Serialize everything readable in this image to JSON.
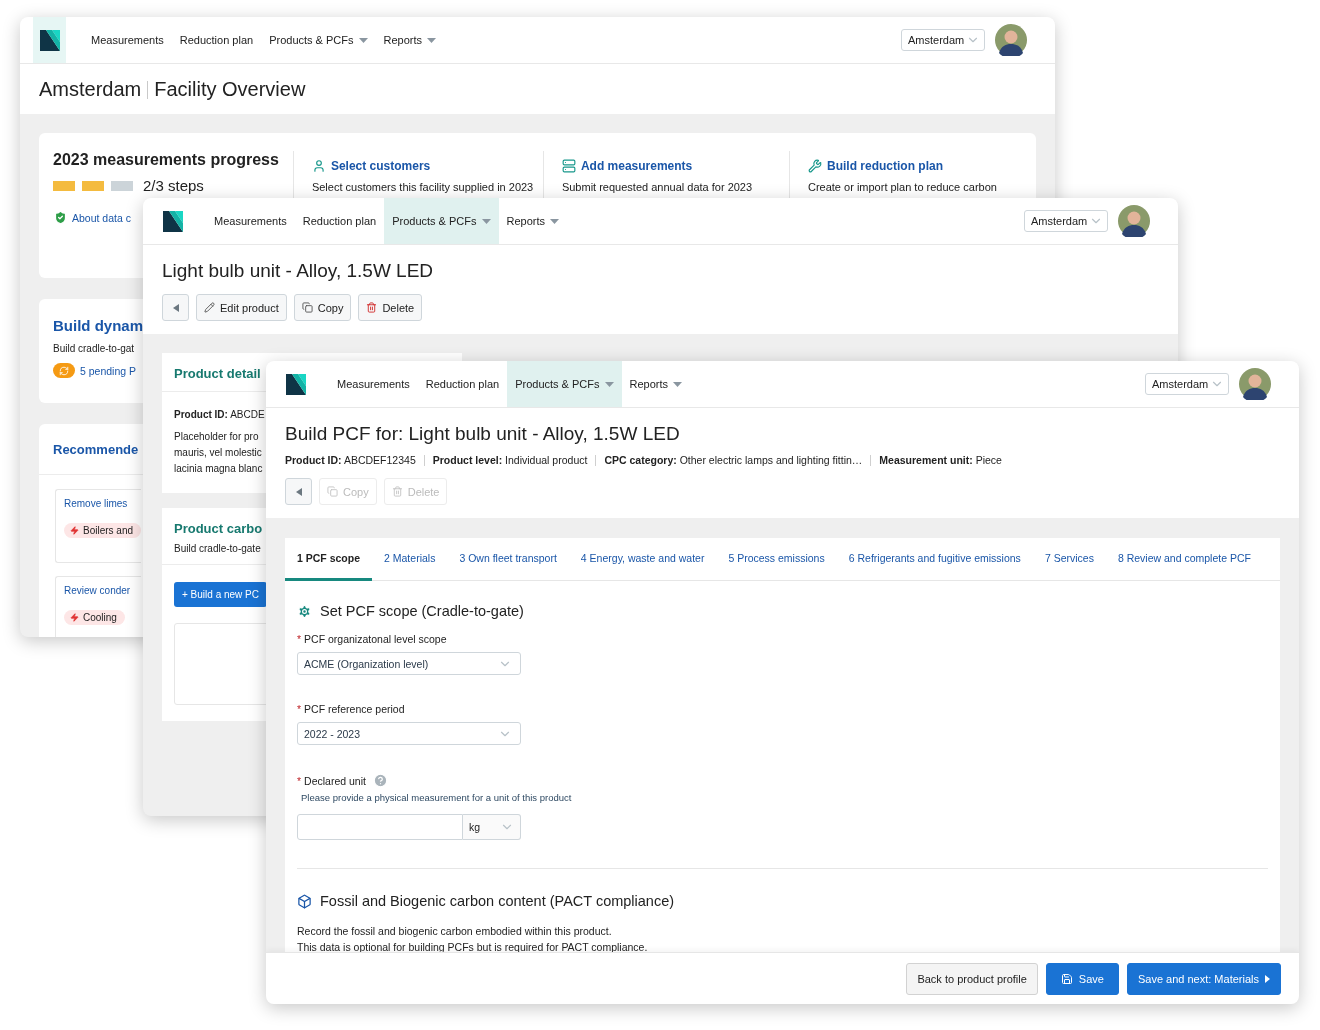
{
  "facility_window": {
    "nav": {
      "home_selected": true,
      "items": [
        {
          "label": "Measurements",
          "has_menu": false,
          "selected": false
        },
        {
          "label": "Reduction plan",
          "has_menu": false,
          "selected": false
        },
        {
          "label": "Products & PCFs",
          "has_menu": true,
          "selected": false
        },
        {
          "label": "Reports",
          "has_menu": true,
          "selected": false
        }
      ],
      "location": "Amsterdam"
    },
    "title": {
      "location": "Amsterdam",
      "page": "Facility Overview"
    },
    "progress": {
      "title": "2023 measurements progress",
      "steps": [
        {
          "done": true
        },
        {
          "done": true
        },
        {
          "done": false
        }
      ],
      "steps_text": "2/3 steps",
      "about_link": "About data c",
      "tasks": [
        {
          "kind": "customers",
          "title": "Select customers",
          "text": "Select customers this facility supplied in 2023"
        },
        {
          "kind": "measurements",
          "title": "Add measurements",
          "text": "Submit requested annual data for 2023"
        },
        {
          "kind": "plan",
          "title": "Build reduction plan",
          "text": "Create or import plan to reduce carbon"
        }
      ]
    },
    "build_card": {
      "title": "Build dynam",
      "text": "Build cradle-to-gat",
      "badge": "5 pending P"
    },
    "recommendations": {
      "title": "Recommende",
      "items": [
        {
          "title": "Remove limes",
          "tag": "Boilers and"
        },
        {
          "title": "Review conder",
          "tag": "Cooling"
        }
      ]
    }
  },
  "product_window": {
    "nav": {
      "home_selected": false,
      "items": [
        {
          "label": "Measurements",
          "has_menu": false,
          "selected": false
        },
        {
          "label": "Reduction plan",
          "has_menu": false,
          "selected": false
        },
        {
          "label": "Products & PCFs",
          "has_menu": true,
          "selected": true
        },
        {
          "label": "Reports",
          "has_menu": true,
          "selected": false
        }
      ],
      "location": "Amsterdam"
    },
    "title": "Light bulb unit - Alloy, 1.5W LED",
    "actions": [
      {
        "kind": "back",
        "disabled": false
      },
      {
        "kind": "edit",
        "label": "Edit product",
        "disabled": false
      },
      {
        "kind": "copy",
        "label": "Copy",
        "disabled": false
      },
      {
        "kind": "delete",
        "label": "Delete",
        "disabled": false
      }
    ],
    "details": {
      "title": "Product detail",
      "id_label": "Product ID:",
      "id_value": "ABCDE",
      "lines": [
        "Placeholder for pro",
        "mauris, vel molestic",
        "lacinia magna blanc"
      ]
    },
    "carbon": {
      "title": "Product carbo",
      "text": "Build cradle-to-gate",
      "button": "+ Build a new PC"
    }
  },
  "pcf_window": {
    "nav": {
      "home_selected": false,
      "items": [
        {
          "label": "Measurements",
          "has_menu": false,
          "selected": false
        },
        {
          "label": "Reduction plan",
          "has_menu": false,
          "selected": false
        },
        {
          "label": "Products & PCFs",
          "has_menu": true,
          "selected": true
        },
        {
          "label": "Reports",
          "has_menu": true,
          "selected": false
        }
      ],
      "location": "Amsterdam"
    },
    "title": "Build PCF for: Light bulb unit - Alloy, 1.5W LED",
    "meta": [
      {
        "label": "Product ID:",
        "value": "ABCDEF12345"
      },
      {
        "label": "Product level:",
        "value": "Individual product"
      },
      {
        "label": "CPC category:",
        "value": "Other electric lamps and lighting fittin…"
      },
      {
        "label": "Measurement unit:",
        "value": "Piece"
      }
    ],
    "actions": [
      {
        "kind": "back",
        "disabled": false
      },
      {
        "kind": "copy",
        "label": "Copy",
        "disabled": true
      },
      {
        "kind": "delete",
        "label": "Delete",
        "disabled": true
      }
    ],
    "tabs": [
      {
        "label": "1 PCF scope",
        "selected": true
      },
      {
        "label": "2 Materials",
        "selected": false
      },
      {
        "label": "3 Own fleet transport",
        "selected": false
      },
      {
        "label": "4 Energy, waste and water",
        "selected": false
      },
      {
        "label": "5 Process emissions",
        "selected": false
      },
      {
        "label": "6 Refrigerants and fugitive emissions",
        "selected": false
      },
      {
        "label": "7 Services",
        "selected": false
      },
      {
        "label": "8 Review and complete PCF",
        "selected": false
      }
    ],
    "scope": {
      "title": "Set PCF scope (Cradle-to-gate)",
      "fields": [
        {
          "kind": "select",
          "marker": "*",
          "label": "PCF organizatonal level scope",
          "value": "ACME (Organization level)"
        },
        {
          "kind": "select",
          "marker": "*",
          "label": "PCF reference period",
          "value": "2022 - 2023"
        },
        {
          "kind": "unit",
          "marker": "*",
          "label": "Declared unit",
          "hint": "Please provide a physical measurement for a unit of this product",
          "unit": "kg"
        }
      ]
    },
    "carbon": {
      "title": "Fossil and Biogenic carbon content (PACT compliance)",
      "lines": [
        "Record the fossil and biogenic carbon embodied within this product.",
        "This data is optional for building PCFs but is required for PACT compliance."
      ]
    },
    "footer": [
      {
        "kind": "secondary",
        "label": "Back to product profile"
      },
      {
        "kind": "save",
        "label": "Save"
      },
      {
        "kind": "next",
        "label": "Save and next: Materials"
      }
    ]
  }
}
